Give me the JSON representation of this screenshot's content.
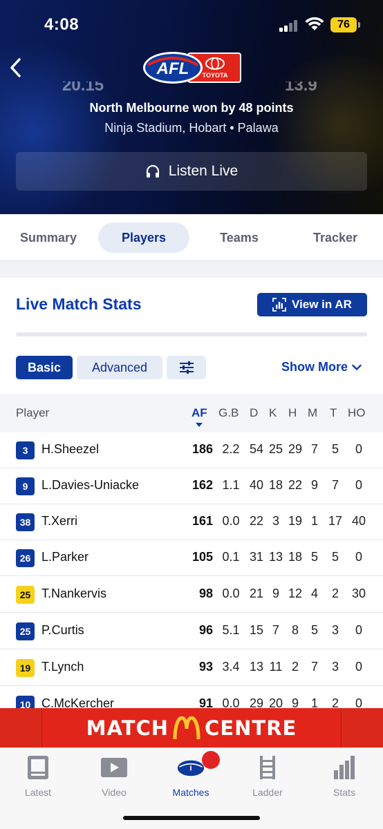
{
  "status_bar": {
    "time": "4:08",
    "battery": "76"
  },
  "header": {
    "score_left": "20.15",
    "score_right": "13.9",
    "result": "North Melbourne won by 48 points",
    "venue": "Ninja Stadium, Hobart • Palawa",
    "listen_label": "Listen Live",
    "logo_text": "AFL",
    "sponsor_text": "TOYOTA"
  },
  "tabs": [
    {
      "label": "Summary"
    },
    {
      "label": "Players"
    },
    {
      "label": "Teams"
    },
    {
      "label": "Tracker"
    }
  ],
  "stats": {
    "title": "Live Match Stats",
    "ar_label": "View in AR",
    "basic_label": "Basic",
    "advanced_label": "Advanced",
    "show_more": "Show More"
  },
  "table": {
    "headers": {
      "player": "Player",
      "af": "AF",
      "gb": "G.B",
      "d": "D",
      "k": "K",
      "h": "H",
      "m": "M",
      "t": "T",
      "ho": "HO"
    },
    "rows": [
      {
        "num": "3",
        "team": "blue",
        "name": "H.Sheezel",
        "af": "186",
        "gb": "2.2",
        "d": "54",
        "k": "25",
        "h": "29",
        "m": "7",
        "t": "5",
        "ho": "0"
      },
      {
        "num": "9",
        "team": "blue",
        "name": "L.Davies-Uniacke",
        "af": "162",
        "gb": "1.1",
        "d": "40",
        "k": "18",
        "h": "22",
        "m": "9",
        "t": "7",
        "ho": "0"
      },
      {
        "num": "38",
        "team": "blue",
        "name": "T.Xerri",
        "af": "161",
        "gb": "0.0",
        "d": "22",
        "k": "3",
        "h": "19",
        "m": "1",
        "t": "17",
        "ho": "40"
      },
      {
        "num": "26",
        "team": "blue",
        "name": "L.Parker",
        "af": "105",
        "gb": "0.1",
        "d": "31",
        "k": "13",
        "h": "18",
        "m": "5",
        "t": "5",
        "ho": "0"
      },
      {
        "num": "25",
        "team": "yellow",
        "name": "T.Nankervis",
        "af": "98",
        "gb": "0.0",
        "d": "21",
        "k": "9",
        "h": "12",
        "m": "4",
        "t": "2",
        "ho": "30"
      },
      {
        "num": "25",
        "team": "blue",
        "name": "P.Curtis",
        "af": "96",
        "gb": "5.1",
        "d": "15",
        "k": "7",
        "h": "8",
        "m": "5",
        "t": "3",
        "ho": "0"
      },
      {
        "num": "19",
        "team": "yellow",
        "name": "T.Lynch",
        "af": "93",
        "gb": "3.4",
        "d": "13",
        "k": "11",
        "h": "2",
        "m": "7",
        "t": "3",
        "ho": "0"
      },
      {
        "num": "10",
        "team": "blue",
        "name": "C.McKercher",
        "af": "91",
        "gb": "0.0",
        "d": "29",
        "k": "20",
        "h": "9",
        "m": "1",
        "t": "2",
        "ho": "0"
      }
    ]
  },
  "banner": {
    "left": "MATCH",
    "right": "CENTRE"
  },
  "colors": {
    "brand_blue": "#0e3a9e",
    "yellow_team": "#f6d11a",
    "banner_red": "#e1251b"
  },
  "bottom_nav": [
    {
      "label": "Latest",
      "icon": "document-icon"
    },
    {
      "label": "Video",
      "icon": "play-icon"
    },
    {
      "label": "Matches",
      "icon": "football-icon"
    },
    {
      "label": "Ladder",
      "icon": "ladder-icon"
    },
    {
      "label": "Stats",
      "icon": "bar-chart-icon"
    }
  ]
}
